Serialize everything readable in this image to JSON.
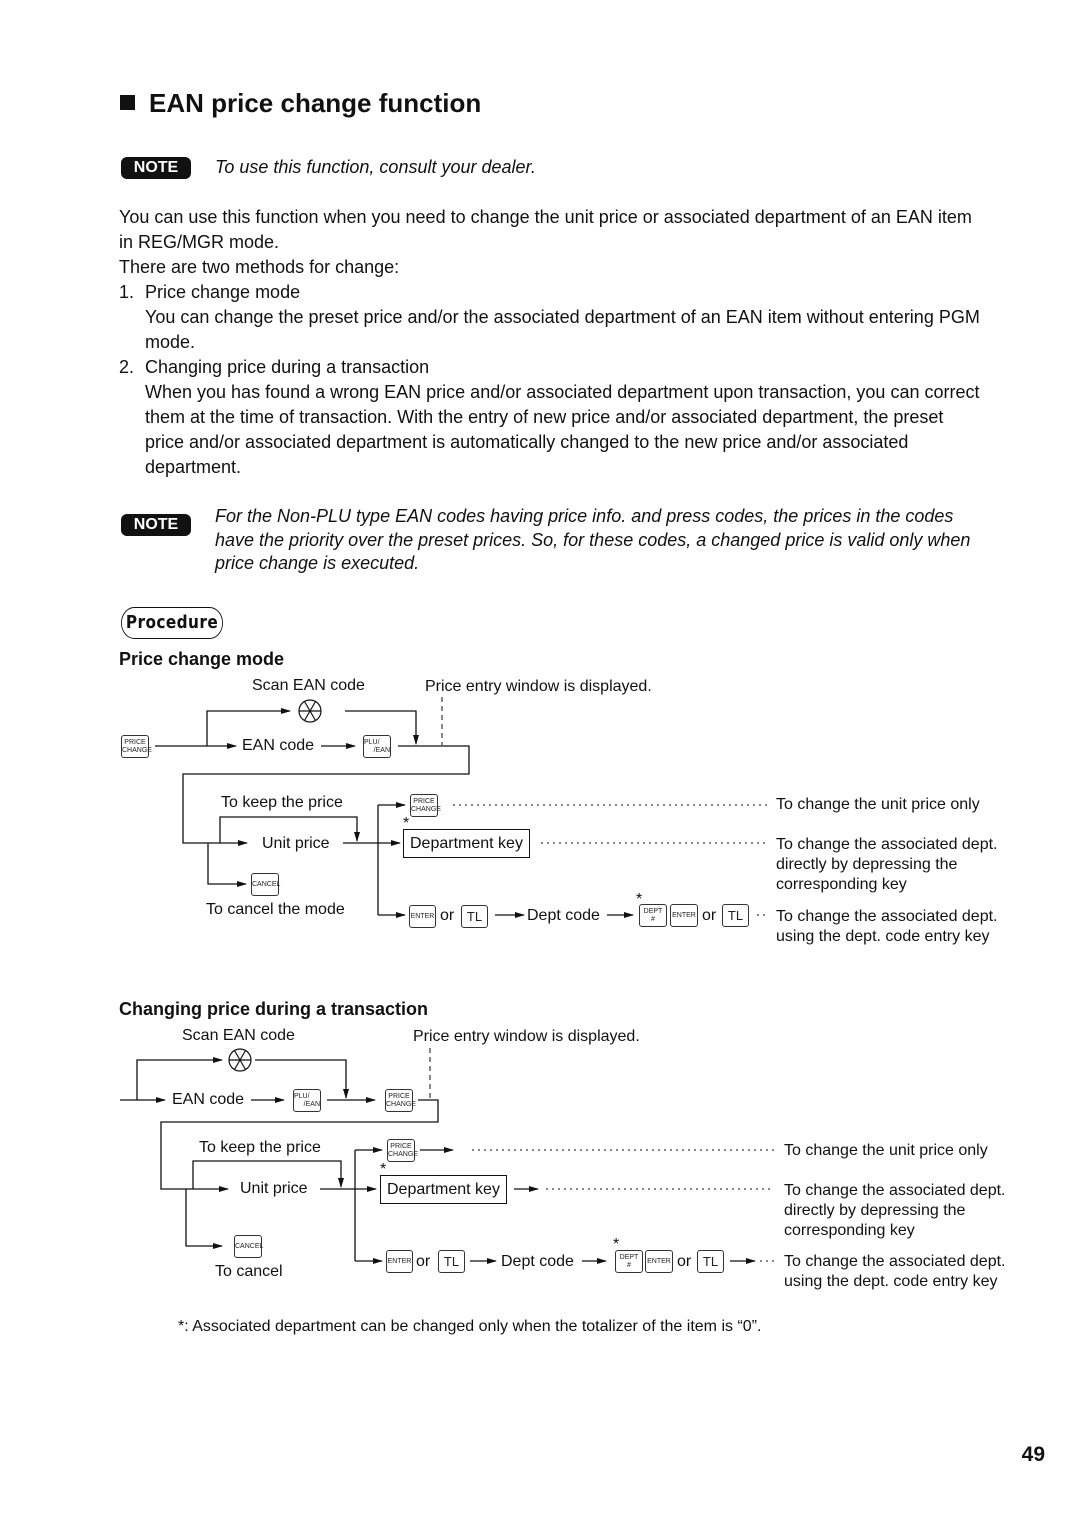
{
  "title": "EAN price change function",
  "note_label": "NOTE",
  "note1": "To use this function, consult your dealer.",
  "intro": [
    "You can use this function when you need to change the unit price or associated department of an EAN item",
    "in REG/MGR mode.",
    "There are two methods for change:"
  ],
  "methods": [
    {
      "num": "1.",
      "title": "Price change mode",
      "desc": [
        "You can change the preset price and/or the associated department of an EAN item without entering PGM",
        "mode."
      ]
    },
    {
      "num": "2.",
      "title": "Changing price during a transaction",
      "desc": [
        "When you has found a wrong EAN price and/or associated department upon transaction, you can correct",
        "them at the time of transaction. With the entry of new price and/or associated department, the preset",
        "price and/or associated department is automatically changed to the new price and/or associated",
        "department."
      ]
    }
  ],
  "note2": [
    "For the Non-PLU type EAN codes having price info. and press codes, the prices in the codes",
    "have the priority over the preset prices.  So, for these codes, a changed price is valid only when",
    "price change is executed."
  ],
  "procedure_label": "Procedure",
  "keys": {
    "price_change": [
      "PRICE",
      "CHANGE"
    ],
    "plu_ean": [
      "PLU/",
      "/EAN"
    ],
    "cancel": "CANCEL",
    "enter": "ENTER",
    "tl": "TL",
    "dept": [
      "DEPT",
      "#"
    ]
  },
  "diagram1": {
    "heading": "Price change mode",
    "scan": "Scan EAN code",
    "window": "Price entry window is displayed.",
    "ean_code": "EAN code",
    "keep": "To keep the price",
    "unit_price": "Unit price",
    "dept_key": "Department key",
    "cancel_text": "To cancel the mode",
    "or": "or",
    "dept_code": "Dept code",
    "asterisk": "*",
    "r1": "To change the unit price only",
    "r2": [
      "To change the associated dept.",
      "directly by depressing the",
      "corresponding key"
    ],
    "r3": [
      "To change the associated dept.",
      "using the dept. code entry key"
    ]
  },
  "diagram2": {
    "heading": "Changing price during a transaction",
    "scan": "Scan EAN code",
    "window": "Price entry window is displayed.",
    "ean_code": "EAN code",
    "keep": "To keep the price",
    "unit_price": "Unit price",
    "dept_key": "Department key",
    "cancel_text": "To cancel",
    "or": "or",
    "dept_code": "Dept code",
    "asterisk": "*",
    "r1": "To change the unit price only",
    "r2": [
      "To change the associated dept.",
      "directly by depressing the",
      "corresponding key"
    ],
    "r3": [
      "To change the associated dept.",
      "using the dept. code entry key"
    ]
  },
  "footnote": "*:  Associated department can be changed only when the totalizer of the item is “0”.",
  "page_number": "49"
}
